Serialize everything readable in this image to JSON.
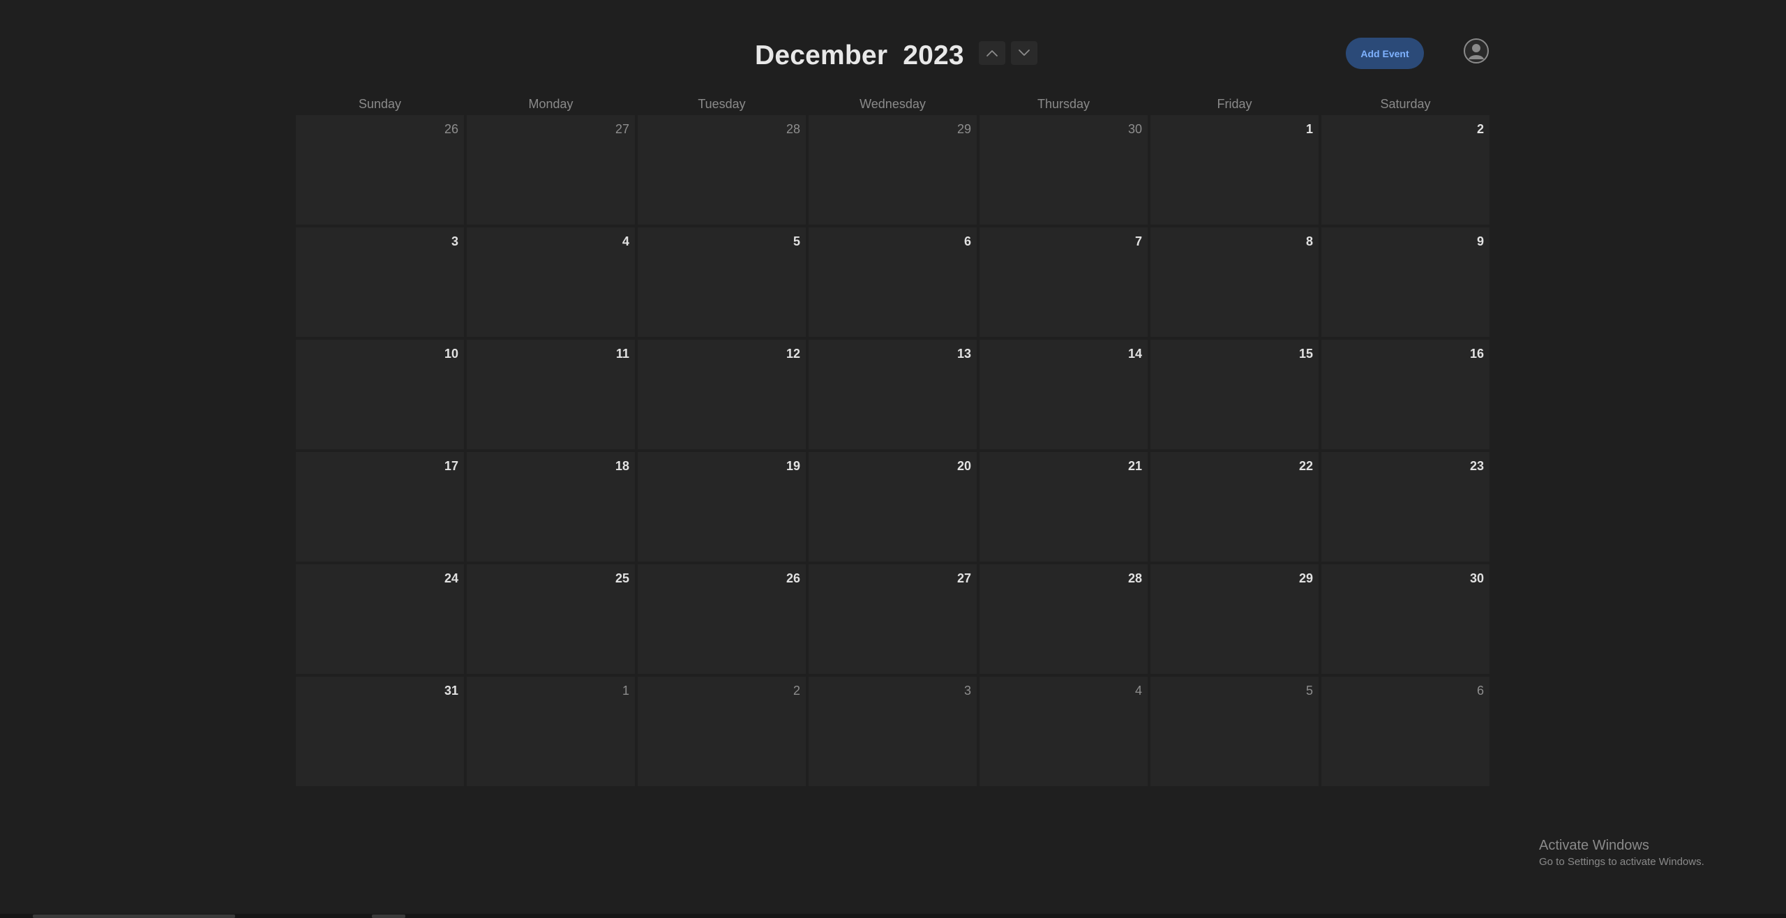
{
  "header": {
    "month": "December",
    "year": "2023",
    "add_event_label": "Add Event",
    "prev_icon": "chevron-up-icon",
    "next_icon": "chevron-down-icon",
    "avatar_icon": "user-avatar-icon"
  },
  "weekdays": [
    "Sunday",
    "Monday",
    "Tuesday",
    "Wednesday",
    "Thursday",
    "Friday",
    "Saturday"
  ],
  "weeks": [
    [
      {
        "n": "26",
        "cur": false
      },
      {
        "n": "27",
        "cur": false
      },
      {
        "n": "28",
        "cur": false
      },
      {
        "n": "29",
        "cur": false
      },
      {
        "n": "30",
        "cur": false
      },
      {
        "n": "1",
        "cur": true
      },
      {
        "n": "2",
        "cur": true
      }
    ],
    [
      {
        "n": "3",
        "cur": true
      },
      {
        "n": "4",
        "cur": true
      },
      {
        "n": "5",
        "cur": true
      },
      {
        "n": "6",
        "cur": true
      },
      {
        "n": "7",
        "cur": true
      },
      {
        "n": "8",
        "cur": true
      },
      {
        "n": "9",
        "cur": true
      }
    ],
    [
      {
        "n": "10",
        "cur": true
      },
      {
        "n": "11",
        "cur": true
      },
      {
        "n": "12",
        "cur": true
      },
      {
        "n": "13",
        "cur": true
      },
      {
        "n": "14",
        "cur": true
      },
      {
        "n": "15",
        "cur": true
      },
      {
        "n": "16",
        "cur": true
      }
    ],
    [
      {
        "n": "17",
        "cur": true
      },
      {
        "n": "18",
        "cur": true
      },
      {
        "n": "19",
        "cur": true
      },
      {
        "n": "20",
        "cur": true
      },
      {
        "n": "21",
        "cur": true
      },
      {
        "n": "22",
        "cur": true
      },
      {
        "n": "23",
        "cur": true
      }
    ],
    [
      {
        "n": "24",
        "cur": true
      },
      {
        "n": "25",
        "cur": true
      },
      {
        "n": "26",
        "cur": true
      },
      {
        "n": "27",
        "cur": true
      },
      {
        "n": "28",
        "cur": true
      },
      {
        "n": "29",
        "cur": true
      },
      {
        "n": "30",
        "cur": true
      }
    ],
    [
      {
        "n": "31",
        "cur": true
      },
      {
        "n": "1",
        "cur": false
      },
      {
        "n": "2",
        "cur": false
      },
      {
        "n": "3",
        "cur": false
      },
      {
        "n": "4",
        "cur": false
      },
      {
        "n": "5",
        "cur": false
      },
      {
        "n": "6",
        "cur": false
      }
    ]
  ],
  "watermark": {
    "title": "Activate Windows",
    "subtitle": "Go to Settings to activate Windows."
  },
  "colors": {
    "background": "#1f1f1f",
    "cell": "#262626",
    "accent_button": "#2b4a78",
    "accent_text": "#7fb2ff"
  }
}
